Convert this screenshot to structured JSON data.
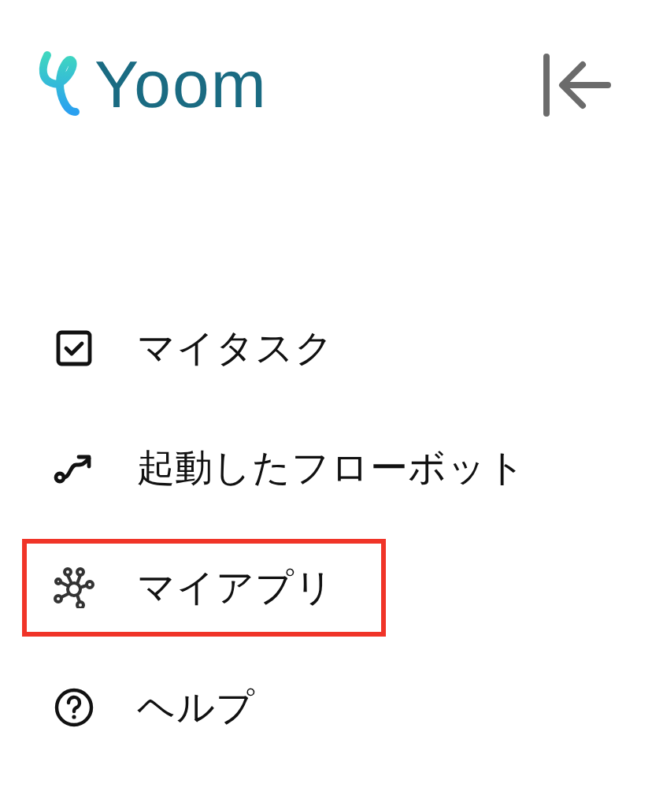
{
  "logo": {
    "text": "Yoom"
  },
  "menu": [
    {
      "kind": "task",
      "label": "マイタスク",
      "highlighted": false
    },
    {
      "kind": "flow",
      "label": "起動したフローボット",
      "highlighted": false
    },
    {
      "kind": "apps",
      "label": "マイアプリ",
      "highlighted": true
    },
    {
      "kind": "help",
      "label": "ヘルプ",
      "highlighted": false
    }
  ]
}
